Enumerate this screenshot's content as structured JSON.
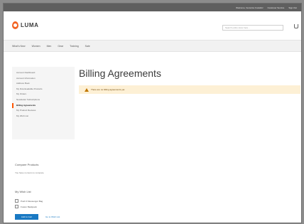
{
  "topbar": {
    "links": [
      "Welcome, Veronica Costello!",
      "Customer Service",
      "Sign Out"
    ]
  },
  "header": {
    "logo_text": "LUMA",
    "search_placeholder": "Search entire store here...",
    "cart_icon": "cart-icon"
  },
  "nav": {
    "items": [
      "What's New",
      "Women",
      "Men",
      "Gear",
      "Training",
      "Sale"
    ]
  },
  "sidebar": {
    "items": [
      {
        "label": "Account Dashboard",
        "active": false
      },
      {
        "label": "Account Information",
        "active": false
      },
      {
        "label": "Address Book",
        "active": false
      },
      {
        "label": "My Downloadable Products",
        "active": false
      },
      {
        "label": "My Orders",
        "active": false
      },
      {
        "label": "Newsletter Subscriptions",
        "active": false
      },
      {
        "label": "Billing Agreements",
        "active": true
      },
      {
        "label": "My Product Reviews",
        "active": false
      },
      {
        "label": "My Wish List",
        "active": false
      }
    ]
  },
  "compare": {
    "title": "Compare Products",
    "empty_text": "You have no items to compare."
  },
  "wishlist": {
    "title": "My Wish List",
    "items": [
      "Push It Messenger Bag",
      "Fusion Backpack"
    ],
    "add_button": "Add to Cart",
    "remove_link": "Go to Wish List"
  },
  "main": {
    "title": "Billing Agreements",
    "notice": "There are no billing agreements yet."
  },
  "colors": {
    "accent": "#1979c3",
    "active_marker": "#ff5501",
    "notice_bg": "#fdf0d5"
  }
}
